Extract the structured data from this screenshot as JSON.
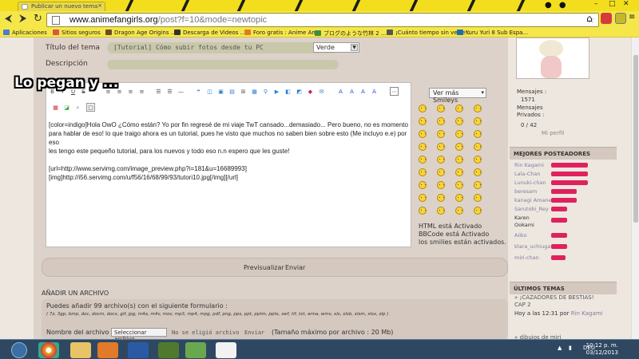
{
  "browser": {
    "tab_title": "Publicar un nuevo tema",
    "url_domain": "www.animefangirls.org",
    "url_path": "/post?f=10&mode=newtopic",
    "bookmarks": [
      {
        "label": "Aplicaciones",
        "color": "#4a7bd1"
      },
      {
        "label": "Sitios seguros",
        "color": "#d9534f"
      },
      {
        "label": "Dragon Age Origins ...",
        "color": "#6b4a2a"
      },
      {
        "label": "Descarga de Videos ...",
        "color": "#333"
      },
      {
        "label": "Foro gratis : Anime An...",
        "color": "#e07b22"
      },
      {
        "label": "ブログのような竹林 2 ...",
        "color": "#3f8e3f"
      },
      {
        "label": "¡Cuánto tiempo sin verte!..",
        "color": "#555"
      },
      {
        "label": "Yuru Yuri 8 Sub Espa...",
        "color": "#1e6db7"
      }
    ]
  },
  "form": {
    "title_label": "Título del tema",
    "title_value": "[Tutorial] Cómo subir fotos desde tu PC",
    "color_value": "Verde",
    "desc_label": "Descripción",
    "editor_lines": [
      "[color=indigo]Hola OwO ¿Cómo están? Yo por fin regresé de mi viaje TwT cansado...demasiado... Pero bueno, no es momento",
      "para hablar de eso! lo que traigo ahora es un tutorial, pues he visto que muchos no saben bien sobre esto (Me incluyo e.e) por eso",
      "les tengo este pequeño tutorial, para los nuevos y todo eso n.n espero que les guste!",
      "",
      "[url=http://www.servimg.com/image_preview.php?i=181&u=16689993]",
      "[img]http://i56.servimg.com/u/f56/16/68/99/93/tutori10.jpg[/img][/url]"
    ],
    "smileys_button": "Ver más Smileys",
    "info_lines": [
      "HTML está Activado",
      "BBCode está Activado",
      "los smilies están activados."
    ],
    "preview_label": "Previsualizar",
    "send_label": "Enviar"
  },
  "upload": {
    "section_title": "AÑADIR UN ARCHIVO",
    "line1": "Puedes añadir 99 archivo(s) con el siguiente formulario :",
    "line2": "( 7z, 3gp, bmp, doc, docm, docx, gif, jpg, m4a, m4v, mov, mp3, mp4, mpg, pdf, png, pps, ppt, pptm, pptx, swf, tif, txt, wma, wmv, xls, xlsb, xlsm, xlsx, zip )",
    "file_label": "Nombre del archivo",
    "file_button": "Seleccionar archivo",
    "file_status": "No se eligió archivo",
    "file_send": "Enviar",
    "file_max": "(Tamaño máximo por archivo : 20 Mb)"
  },
  "sidebar": {
    "messages_label": "Mensajes :",
    "messages_value": "1571",
    "private_label": "Mensajes Privados :",
    "private_value": "0 / 42",
    "profile_link": "Mi perfil",
    "top_posters_title": "MEJORES POSTEADORES",
    "top_posters": [
      "Rin Kagami",
      "Lala-Chan",
      "Lunuki-chan",
      "beresam",
      "kanagi Amane",
      "Sarutobi_Rey",
      "Karen Ookami",
      "Aiiko",
      "klara_uchiuga",
      "miri-chan"
    ],
    "latest_title": "ÚLTIMOS TEMAS",
    "latest_topic_1": "» ¡CAZADORES DE BESTIAS! CAP 2",
    "latest_topic_1_time": "Hoy a las 12:31 por",
    "latest_topic_1_author": "Rin Kagami",
    "latest_topic_2": "» dibujos de miri"
  },
  "overlay_text": "Lo pegan y ...",
  "taskbar": {
    "language": "DEU",
    "time": "10:12 p. m.",
    "date": "03/12/2013"
  }
}
